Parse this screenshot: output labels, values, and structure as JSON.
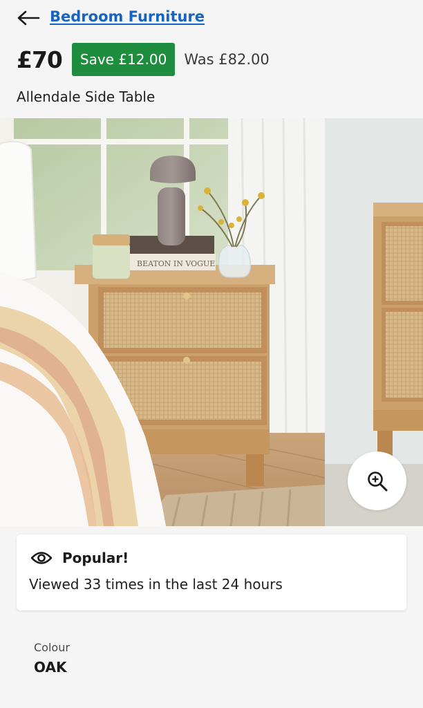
{
  "header": {
    "back_icon": "arrow-left-icon",
    "breadcrumb": "Bedroom Furniture"
  },
  "price": {
    "current": "£70",
    "save": "Save £12.00",
    "was": "Was £82.00",
    "save_color": "#1e8e3e"
  },
  "product": {
    "title": "Allendale Side Table"
  },
  "gallery": {
    "book_spine_text": "BEATON IN VOGUE",
    "zoom_icon": "zoom-in-icon"
  },
  "popular": {
    "icon": "eye-icon",
    "title": "Popular!",
    "text": "Viewed 33 times in the last 24 hours"
  },
  "colour": {
    "label": "Colour",
    "value": "OAK"
  },
  "colors": {
    "link": "#1565c0",
    "background": "#f5f5f5"
  }
}
